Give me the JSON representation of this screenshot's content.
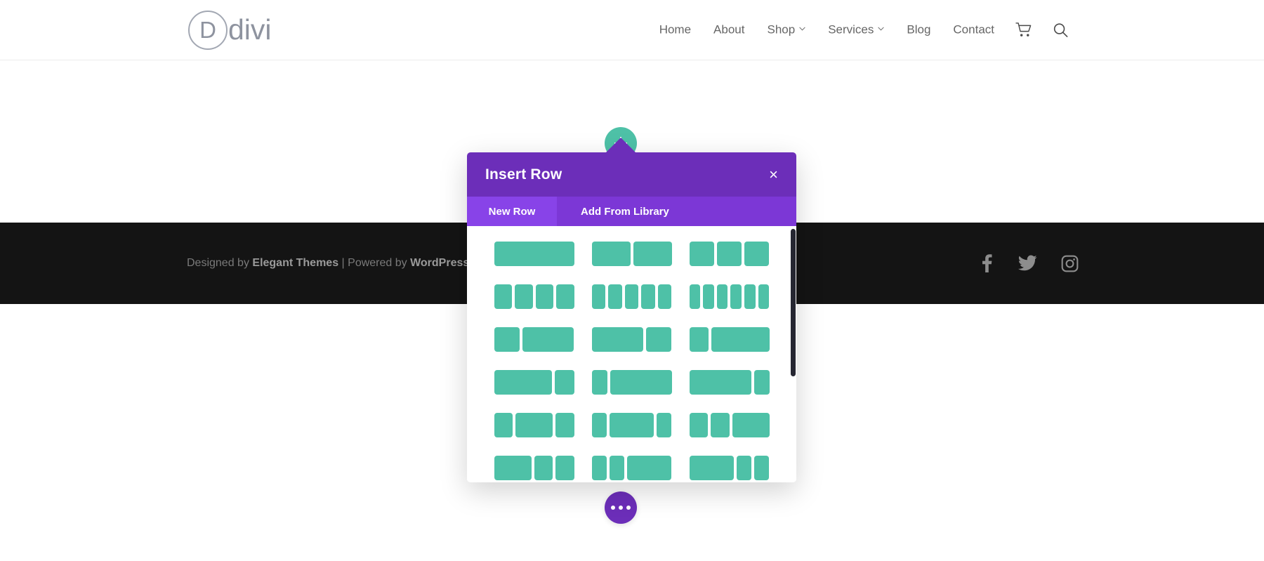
{
  "site": {
    "logo": {
      "mark": "D",
      "text": "divi"
    },
    "nav": [
      {
        "label": "Home",
        "has_caret": false
      },
      {
        "label": "About",
        "has_caret": false
      },
      {
        "label": "Shop",
        "has_caret": true
      },
      {
        "label": "Services",
        "has_caret": true
      },
      {
        "label": "Blog",
        "has_caret": false
      },
      {
        "label": "Contact",
        "has_caret": false
      }
    ],
    "icons": [
      {
        "name": "cart-icon"
      },
      {
        "name": "search-icon"
      }
    ]
  },
  "footer": {
    "credit_prefix": "Designed by ",
    "credit_brand": "Elegant Themes",
    "credit_mid": " | Powered by ",
    "credit_brand2": "WordPress",
    "social": [
      {
        "name": "facebook-icon"
      },
      {
        "name": "twitter-icon"
      },
      {
        "name": "instagram-icon"
      }
    ]
  },
  "builder": {
    "add_row_button": {
      "name": "add-row-button",
      "glyph": "+"
    },
    "settings_button": {
      "name": "page-settings-button",
      "glyph": "•••"
    }
  },
  "modal": {
    "title": "Insert Row",
    "close_label": "×",
    "tabs": [
      {
        "label": "New Row",
        "active": true
      },
      {
        "label": "Add From Library",
        "active": false
      }
    ],
    "colors": {
      "header": "#6c2eb9",
      "tab_active": "#8843e8",
      "tab_inactive": "#7c37d6",
      "column_green": "#4ec1a7"
    },
    "layouts": [
      {
        "name": "1-column",
        "widths": [
          100
        ]
      },
      {
        "name": "2-column-equal",
        "widths": [
          50,
          50
        ]
      },
      {
        "name": "3-column-equal",
        "widths": [
          33.33,
          33.33,
          33.33
        ]
      },
      {
        "name": "4-column-equal",
        "widths": [
          25,
          25,
          25,
          25
        ]
      },
      {
        "name": "5-column-equal",
        "widths": [
          20,
          20,
          20,
          20,
          20
        ]
      },
      {
        "name": "6-column-equal",
        "widths": [
          16.66,
          16.66,
          16.66,
          16.66,
          16.66,
          16.66
        ]
      },
      {
        "name": "one-third-two-thirds",
        "widths": [
          33.33,
          66.66
        ]
      },
      {
        "name": "two-thirds-one-third",
        "widths": [
          66.66,
          33.33
        ]
      },
      {
        "name": "one-quarter-three-quarters",
        "widths": [
          25,
          75
        ]
      },
      {
        "name": "three-quarters-one-quarter",
        "widths": [
          75,
          25
        ]
      },
      {
        "name": "one-fifth-four-fifths",
        "widths": [
          20,
          80
        ]
      },
      {
        "name": "four-fifths-one-fifth",
        "widths": [
          80,
          20
        ]
      },
      {
        "name": "quarter-half-quarter",
        "widths": [
          25,
          50,
          25
        ]
      },
      {
        "name": "fifth-three-fifths-fifth",
        "widths": [
          20,
          60,
          20
        ]
      },
      {
        "name": "quarter-quarter-half",
        "widths": [
          25,
          25,
          50
        ]
      },
      {
        "name": "half-quarter-quarter",
        "widths": [
          50,
          25,
          25
        ]
      },
      {
        "name": "fifth-fifth-three-fifths",
        "widths": [
          20,
          20,
          60
        ]
      },
      {
        "name": "three-fifths-fifth-fifth",
        "widths": [
          60,
          20,
          20
        ]
      }
    ]
  }
}
